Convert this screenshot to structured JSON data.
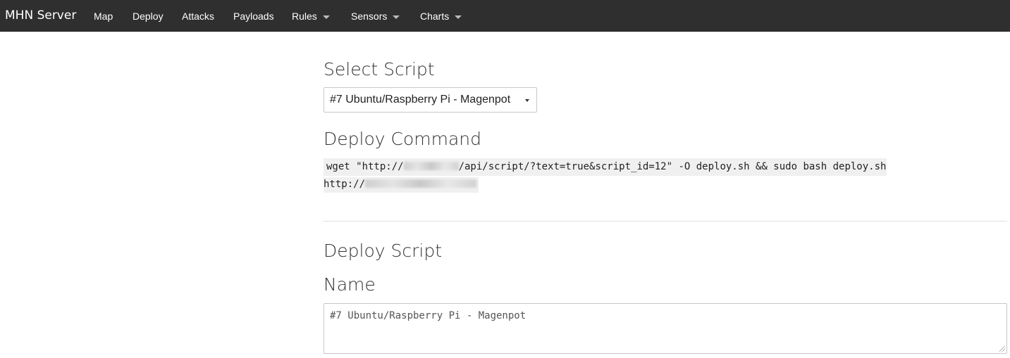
{
  "navbar": {
    "brand": "MHN Server",
    "items": [
      {
        "label": "Map",
        "dropdown": false
      },
      {
        "label": "Deploy",
        "dropdown": false
      },
      {
        "label": "Attacks",
        "dropdown": false
      },
      {
        "label": "Payloads",
        "dropdown": false
      },
      {
        "label": "Rules",
        "dropdown": true
      },
      {
        "label": "Sensors",
        "dropdown": true
      },
      {
        "label": "Charts",
        "dropdown": true
      }
    ]
  },
  "select_script": {
    "heading": "Select Script",
    "selected_value": "#7 Ubuntu/Raspberry Pi - Magenpot"
  },
  "deploy_command": {
    "heading": "Deploy Command",
    "line1_prefix": "wget \"http://",
    "line1_suffix": "/api/script/?text=true&script_id=12\" -O deploy.sh && sudo bash deploy.sh",
    "line2_prefix": "http://"
  },
  "deploy_script": {
    "heading": "Deploy Script",
    "name_label": "Name",
    "name_value": "#7 Ubuntu/Raspberry Pi - Magenpot"
  },
  "colors": {
    "navbar_bg": "#2f2f2f",
    "nav_text": "#ffffff",
    "code_bg": "#f0f0f0"
  }
}
